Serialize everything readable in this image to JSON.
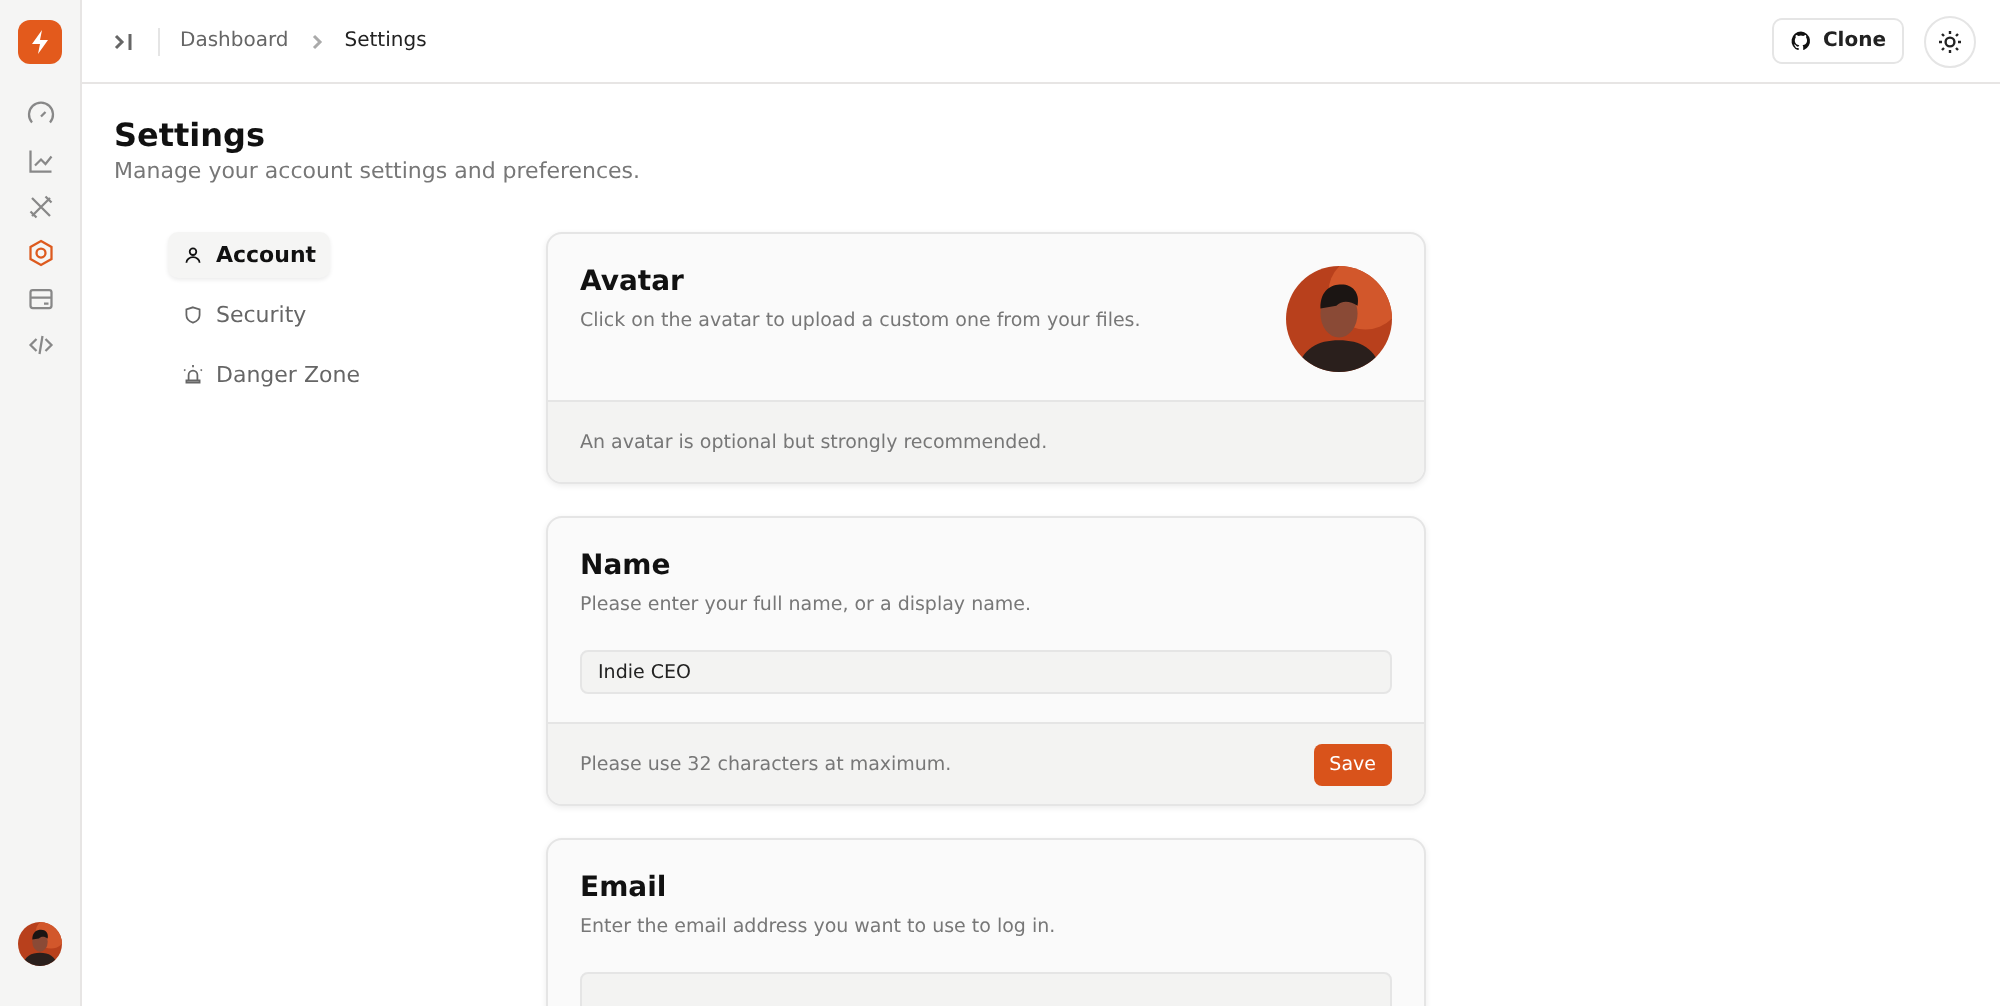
{
  "rail": {
    "items": [
      {
        "selected": false
      },
      {
        "selected": false
      },
      {
        "selected": false
      },
      {
        "selected": true
      },
      {
        "selected": false
      },
      {
        "selected": false
      }
    ]
  },
  "breadcrumb": [
    "Dashboard",
    "Settings"
  ],
  "header_buttons": {
    "clone": "Clone"
  },
  "page": {
    "title": "Settings",
    "subtitle": "Manage your account settings and preferences."
  },
  "settings_nav": [
    {
      "label": "Account",
      "selected": true
    },
    {
      "label": "Security",
      "selected": false
    },
    {
      "label": "Danger Zone",
      "selected": false
    }
  ],
  "cards": [
    {
      "kind": "avatar",
      "title": "Avatar",
      "description": "Click on the avatar to upload a custom one from your files.",
      "footer": "An avatar is optional but strongly recommended."
    },
    {
      "kind": "field",
      "title": "Name",
      "description": "Please enter your full name, or a display name.",
      "value": "Indie CEO",
      "footer": "Please use 32 characters at maximum.",
      "button": "Save"
    },
    {
      "kind": "field",
      "title": "Email",
      "description": "Enter the email address you want to use to log in."
    }
  ]
}
